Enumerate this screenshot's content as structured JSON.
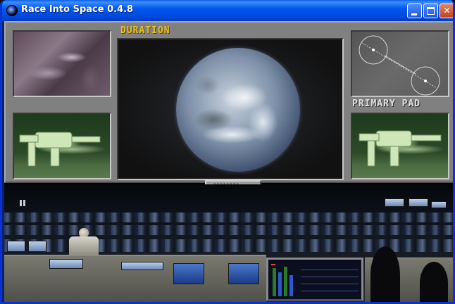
{
  "window": {
    "title": "Race Into Space 0.4.8",
    "buttons": {
      "minimize": "",
      "maximize": "",
      "close": "✕"
    }
  },
  "game": {
    "viewer_caption": "DURATION",
    "pad_caption": "PRIMARY PAD",
    "caption_color": "#e8c020",
    "panels": [
      {
        "name": "terrain-view",
        "icon": "lunar-terrain"
      },
      {
        "name": "station-view-left",
        "icon": "space-station"
      },
      {
        "name": "earth-view",
        "icon": "earth-globe"
      },
      {
        "name": "orbit-diagram",
        "icon": "orbit-map"
      },
      {
        "name": "station-view-right",
        "icon": "space-station"
      }
    ],
    "controls": {
      "knob_count": 4
    }
  }
}
